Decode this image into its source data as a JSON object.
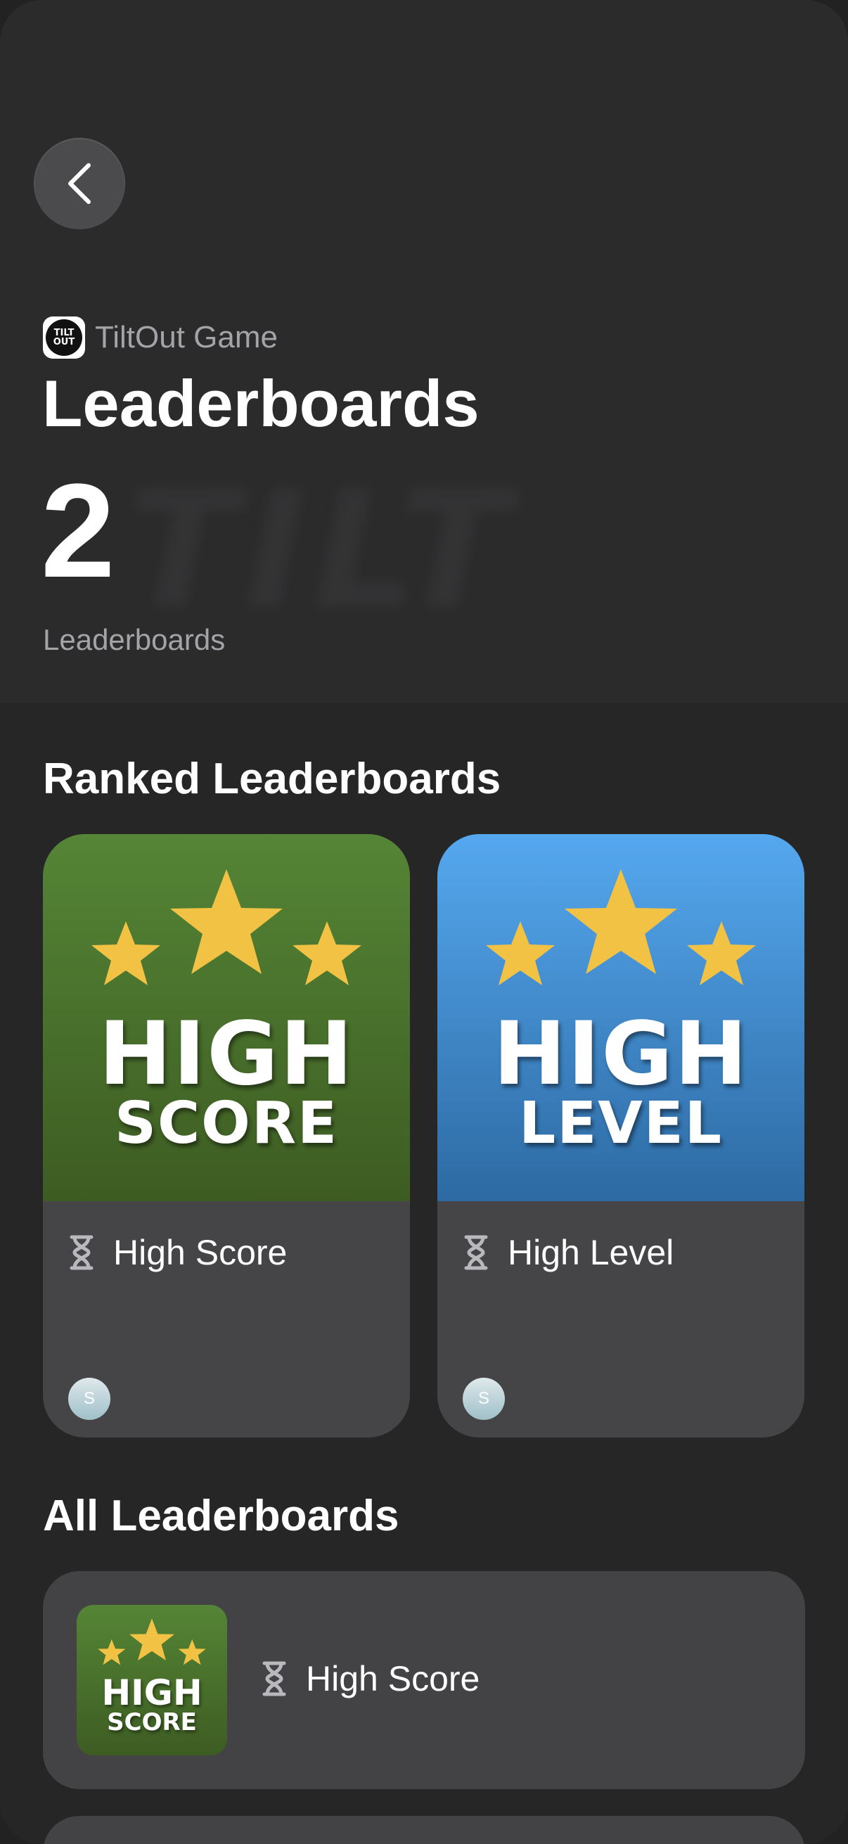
{
  "app": {
    "name": "TiltOut Game",
    "icon_text_top": "TILT",
    "icon_text_bottom": "OUT"
  },
  "page": {
    "title": "Leaderboards",
    "count": "2",
    "count_label": "Leaderboards",
    "background_watermark": "TILT"
  },
  "sections": {
    "ranked_title": "Ranked Leaderboards",
    "all_title": "All Leaderboards"
  },
  "ranked": [
    {
      "label": "High Score",
      "art_line1": "HIGH",
      "art_line2": "SCORE",
      "avatar_initial": "S",
      "art_color": "#4a7a2e"
    },
    {
      "label": "High Level",
      "art_line1": "HIGH",
      "art_line2": "LEVEL",
      "avatar_initial": "S",
      "art_color": "#3f8fd6"
    }
  ],
  "all": [
    {
      "label": "High Score",
      "art_line1": "HIGH",
      "art_line2": "SCORE"
    }
  ],
  "icons": {
    "back": "chevron-left-icon",
    "timer": "hourglass-icon",
    "star": "star-icon"
  },
  "colors": {
    "star": "#f2c244",
    "background": "#2a2a2b",
    "card": "#454547"
  }
}
